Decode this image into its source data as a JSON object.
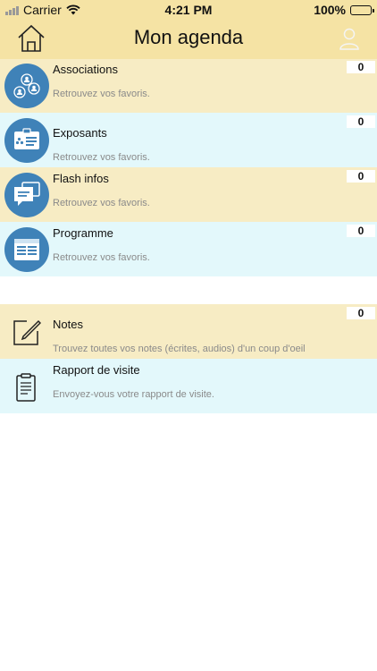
{
  "status_bar": {
    "carrier": "Carrier",
    "time": "4:21 PM",
    "battery": "100%"
  },
  "header": {
    "title": "Mon agenda",
    "home_icon": "home-icon",
    "user_icon": "user-icon"
  },
  "favorites": [
    {
      "label": "Associations",
      "subtitle": "Retrouvez vos favoris.",
      "count": "0",
      "icon": "associations-icon"
    },
    {
      "label": "Exposants",
      "subtitle": "Retrouvez vos favoris.",
      "count": "0",
      "icon": "badge-icon"
    },
    {
      "label": "Flash infos",
      "subtitle": "Retrouvez vos favoris.",
      "count": "0",
      "icon": "chat-bubbles-icon"
    },
    {
      "label": "Programme",
      "subtitle": "Retrouvez vos favoris.",
      "count": "0",
      "icon": "calendar-icon"
    }
  ],
  "tools": [
    {
      "label": "Notes",
      "subtitle": "Trouvez toutes vos notes (écrites, audios) d'un coup d'oeil",
      "count": "0",
      "icon": "edit-note-icon"
    },
    {
      "label": "Rapport de visite",
      "subtitle": "Envoyez-vous votre rapport de visite.",
      "icon": "clipboard-icon"
    }
  ],
  "colors": {
    "header_bg": "#f5e3a4",
    "row_yellow": "#f7ecc4",
    "row_cyan": "#e3f8fb",
    "icon_blue": "#3f82b8"
  }
}
